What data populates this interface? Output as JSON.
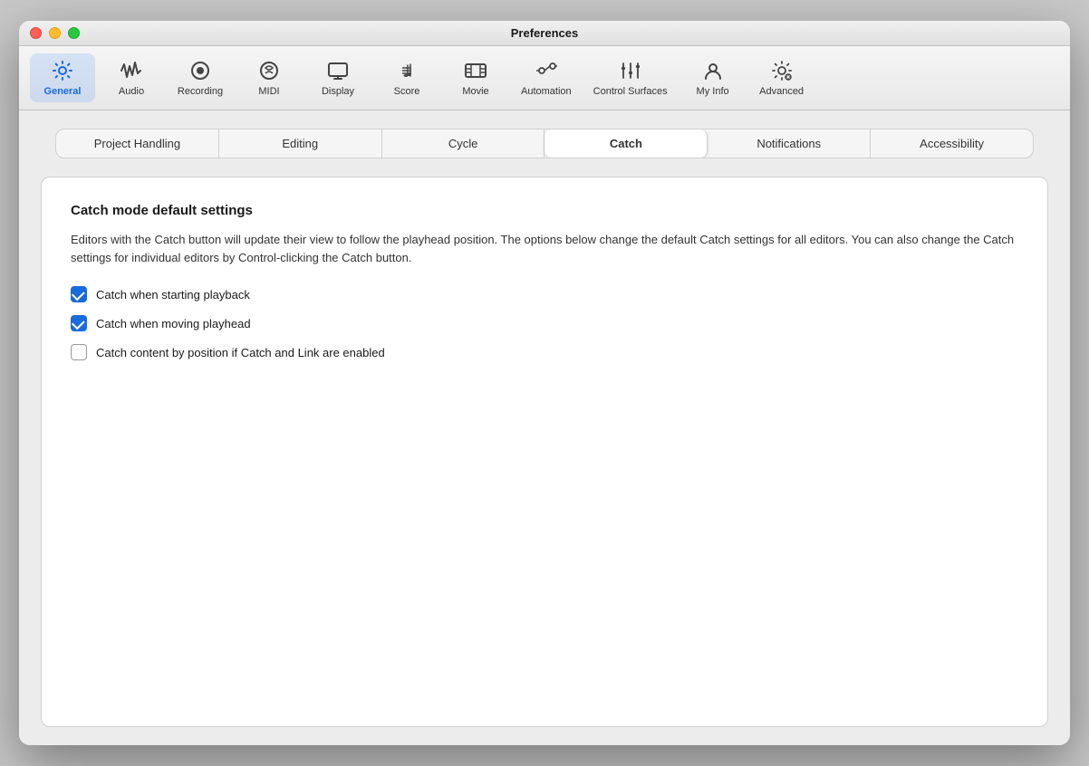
{
  "window": {
    "title": "Preferences"
  },
  "toolbar": {
    "items": [
      {
        "id": "general",
        "label": "General",
        "icon": "gear",
        "active": true
      },
      {
        "id": "audio",
        "label": "Audio",
        "icon": "audio",
        "active": false
      },
      {
        "id": "recording",
        "label": "Recording",
        "icon": "recording",
        "active": false
      },
      {
        "id": "midi",
        "label": "MIDI",
        "icon": "midi",
        "active": false
      },
      {
        "id": "display",
        "label": "Display",
        "icon": "display",
        "active": false
      },
      {
        "id": "score",
        "label": "Score",
        "icon": "score",
        "active": false
      },
      {
        "id": "movie",
        "label": "Movie",
        "icon": "movie",
        "active": false
      },
      {
        "id": "automation",
        "label": "Automation",
        "icon": "automation",
        "active": false
      },
      {
        "id": "control-surfaces",
        "label": "Control Surfaces",
        "icon": "control-surfaces",
        "active": false
      },
      {
        "id": "my-info",
        "label": "My Info",
        "icon": "my-info",
        "active": false
      },
      {
        "id": "advanced",
        "label": "Advanced",
        "icon": "advanced",
        "active": false
      }
    ]
  },
  "subtabs": {
    "items": [
      {
        "id": "project-handling",
        "label": "Project Handling",
        "active": false
      },
      {
        "id": "editing",
        "label": "Editing",
        "active": false
      },
      {
        "id": "cycle",
        "label": "Cycle",
        "active": false
      },
      {
        "id": "catch",
        "label": "Catch",
        "active": true
      },
      {
        "id": "notifications",
        "label": "Notifications",
        "active": false
      },
      {
        "id": "accessibility",
        "label": "Accessibility",
        "active": false
      }
    ]
  },
  "panel": {
    "title": "Catch mode default settings",
    "description": "Editors with the Catch button will update their view to follow the playhead position. The options below change the default Catch settings for all editors. You can also change the Catch settings for individual editors by Control-clicking the Catch button.",
    "checkboxes": [
      {
        "id": "catch-playback",
        "label": "Catch when starting playback",
        "checked": true
      },
      {
        "id": "catch-moving",
        "label": "Catch when moving playhead",
        "checked": true
      },
      {
        "id": "catch-content",
        "label": "Catch content by position if Catch and Link are enabled",
        "checked": false
      }
    ]
  },
  "traffic_lights": {
    "close": "close",
    "minimize": "minimize",
    "maximize": "maximize"
  }
}
